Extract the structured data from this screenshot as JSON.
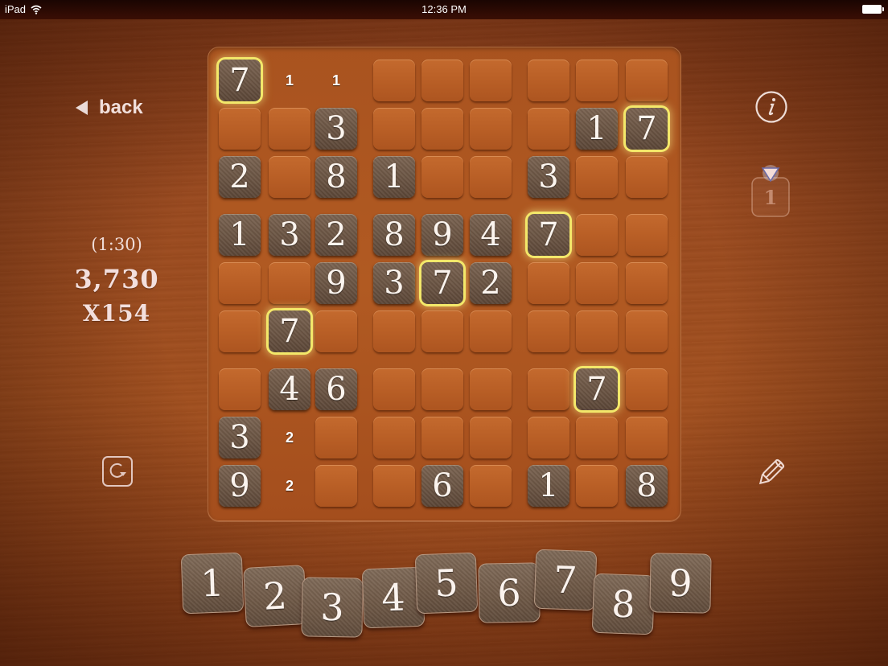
{
  "status_bar": {
    "device": "iPad",
    "time": "12:36 PM",
    "wifi_icon": "wifi-icon",
    "battery_icon": "battery-icon"
  },
  "nav": {
    "back_label": "back",
    "back_icon": "left-triangle-icon"
  },
  "stats": {
    "timer": "(1:30)",
    "score": "3,730",
    "multiplier": "X154"
  },
  "controls": {
    "restart_icon": "restart-icon",
    "info_icon": "info-icon",
    "hint_count": "1",
    "hint_icon": "hint-funnel-icon",
    "pencil_icon": "pencil-icon"
  },
  "theme": {
    "highlight_color": "#f3e86a",
    "given_tile_color": "#6a5443",
    "empty_cell_color": "#b95f26",
    "text_color": "#fbf4ee"
  },
  "board": {
    "rows": [
      [
        {
          "v": "7",
          "t": "given",
          "hl": true
        },
        {
          "v": "1",
          "t": "note"
        },
        {
          "v": "1",
          "t": "note"
        },
        {
          "v": "",
          "t": "empty"
        },
        {
          "v": "",
          "t": "empty"
        },
        {
          "v": "",
          "t": "empty"
        },
        {
          "v": "",
          "t": "empty"
        },
        {
          "v": "",
          "t": "empty"
        },
        {
          "v": "",
          "t": "empty"
        }
      ],
      [
        {
          "v": "",
          "t": "empty"
        },
        {
          "v": "",
          "t": "empty"
        },
        {
          "v": "3",
          "t": "given"
        },
        {
          "v": "",
          "t": "empty"
        },
        {
          "v": "",
          "t": "empty"
        },
        {
          "v": "",
          "t": "empty"
        },
        {
          "v": "",
          "t": "empty"
        },
        {
          "v": "1",
          "t": "given"
        },
        {
          "v": "7",
          "t": "given",
          "hl": true
        }
      ],
      [
        {
          "v": "2",
          "t": "given"
        },
        {
          "v": "",
          "t": "empty"
        },
        {
          "v": "8",
          "t": "given"
        },
        {
          "v": "1",
          "t": "given"
        },
        {
          "v": "",
          "t": "empty"
        },
        {
          "v": "",
          "t": "empty"
        },
        {
          "v": "3",
          "t": "given"
        },
        {
          "v": "",
          "t": "empty"
        },
        {
          "v": "",
          "t": "empty"
        }
      ],
      [
        {
          "v": "1",
          "t": "given"
        },
        {
          "v": "3",
          "t": "given"
        },
        {
          "v": "2",
          "t": "given"
        },
        {
          "v": "8",
          "t": "given"
        },
        {
          "v": "9",
          "t": "given"
        },
        {
          "v": "4",
          "t": "given"
        },
        {
          "v": "7",
          "t": "given",
          "hl": true
        },
        {
          "v": "",
          "t": "empty"
        },
        {
          "v": "",
          "t": "empty"
        }
      ],
      [
        {
          "v": "",
          "t": "empty"
        },
        {
          "v": "",
          "t": "empty"
        },
        {
          "v": "9",
          "t": "given"
        },
        {
          "v": "3",
          "t": "given"
        },
        {
          "v": "7",
          "t": "given",
          "hl": true
        },
        {
          "v": "2",
          "t": "given"
        },
        {
          "v": "",
          "t": "empty"
        },
        {
          "v": "",
          "t": "empty"
        },
        {
          "v": "",
          "t": "empty"
        }
      ],
      [
        {
          "v": "",
          "t": "empty"
        },
        {
          "v": "7",
          "t": "given",
          "hl": true
        },
        {
          "v": "",
          "t": "empty"
        },
        {
          "v": "",
          "t": "empty"
        },
        {
          "v": "",
          "t": "empty"
        },
        {
          "v": "",
          "t": "empty"
        },
        {
          "v": "",
          "t": "empty"
        },
        {
          "v": "",
          "t": "empty"
        },
        {
          "v": "",
          "t": "empty"
        }
      ],
      [
        {
          "v": "",
          "t": "empty"
        },
        {
          "v": "4",
          "t": "given"
        },
        {
          "v": "6",
          "t": "given"
        },
        {
          "v": "",
          "t": "empty"
        },
        {
          "v": "",
          "t": "empty"
        },
        {
          "v": "",
          "t": "empty"
        },
        {
          "v": "",
          "t": "empty"
        },
        {
          "v": "7",
          "t": "given",
          "hl": true
        },
        {
          "v": "",
          "t": "empty"
        }
      ],
      [
        {
          "v": "3",
          "t": "given"
        },
        {
          "v": "2",
          "t": "note"
        },
        {
          "v": "",
          "t": "empty"
        },
        {
          "v": "",
          "t": "empty"
        },
        {
          "v": "",
          "t": "empty"
        },
        {
          "v": "",
          "t": "empty"
        },
        {
          "v": "",
          "t": "empty"
        },
        {
          "v": "",
          "t": "empty"
        },
        {
          "v": "",
          "t": "empty"
        }
      ],
      [
        {
          "v": "9",
          "t": "given"
        },
        {
          "v": "2",
          "t": "note"
        },
        {
          "v": "",
          "t": "empty"
        },
        {
          "v": "",
          "t": "empty"
        },
        {
          "v": "6",
          "t": "given"
        },
        {
          "v": "",
          "t": "empty"
        },
        {
          "v": "1",
          "t": "given"
        },
        {
          "v": "",
          "t": "empty"
        },
        {
          "v": "8",
          "t": "given"
        }
      ]
    ]
  },
  "number_tiles": [
    "1",
    "2",
    "3",
    "4",
    "5",
    "6",
    "7",
    "8",
    "9"
  ]
}
